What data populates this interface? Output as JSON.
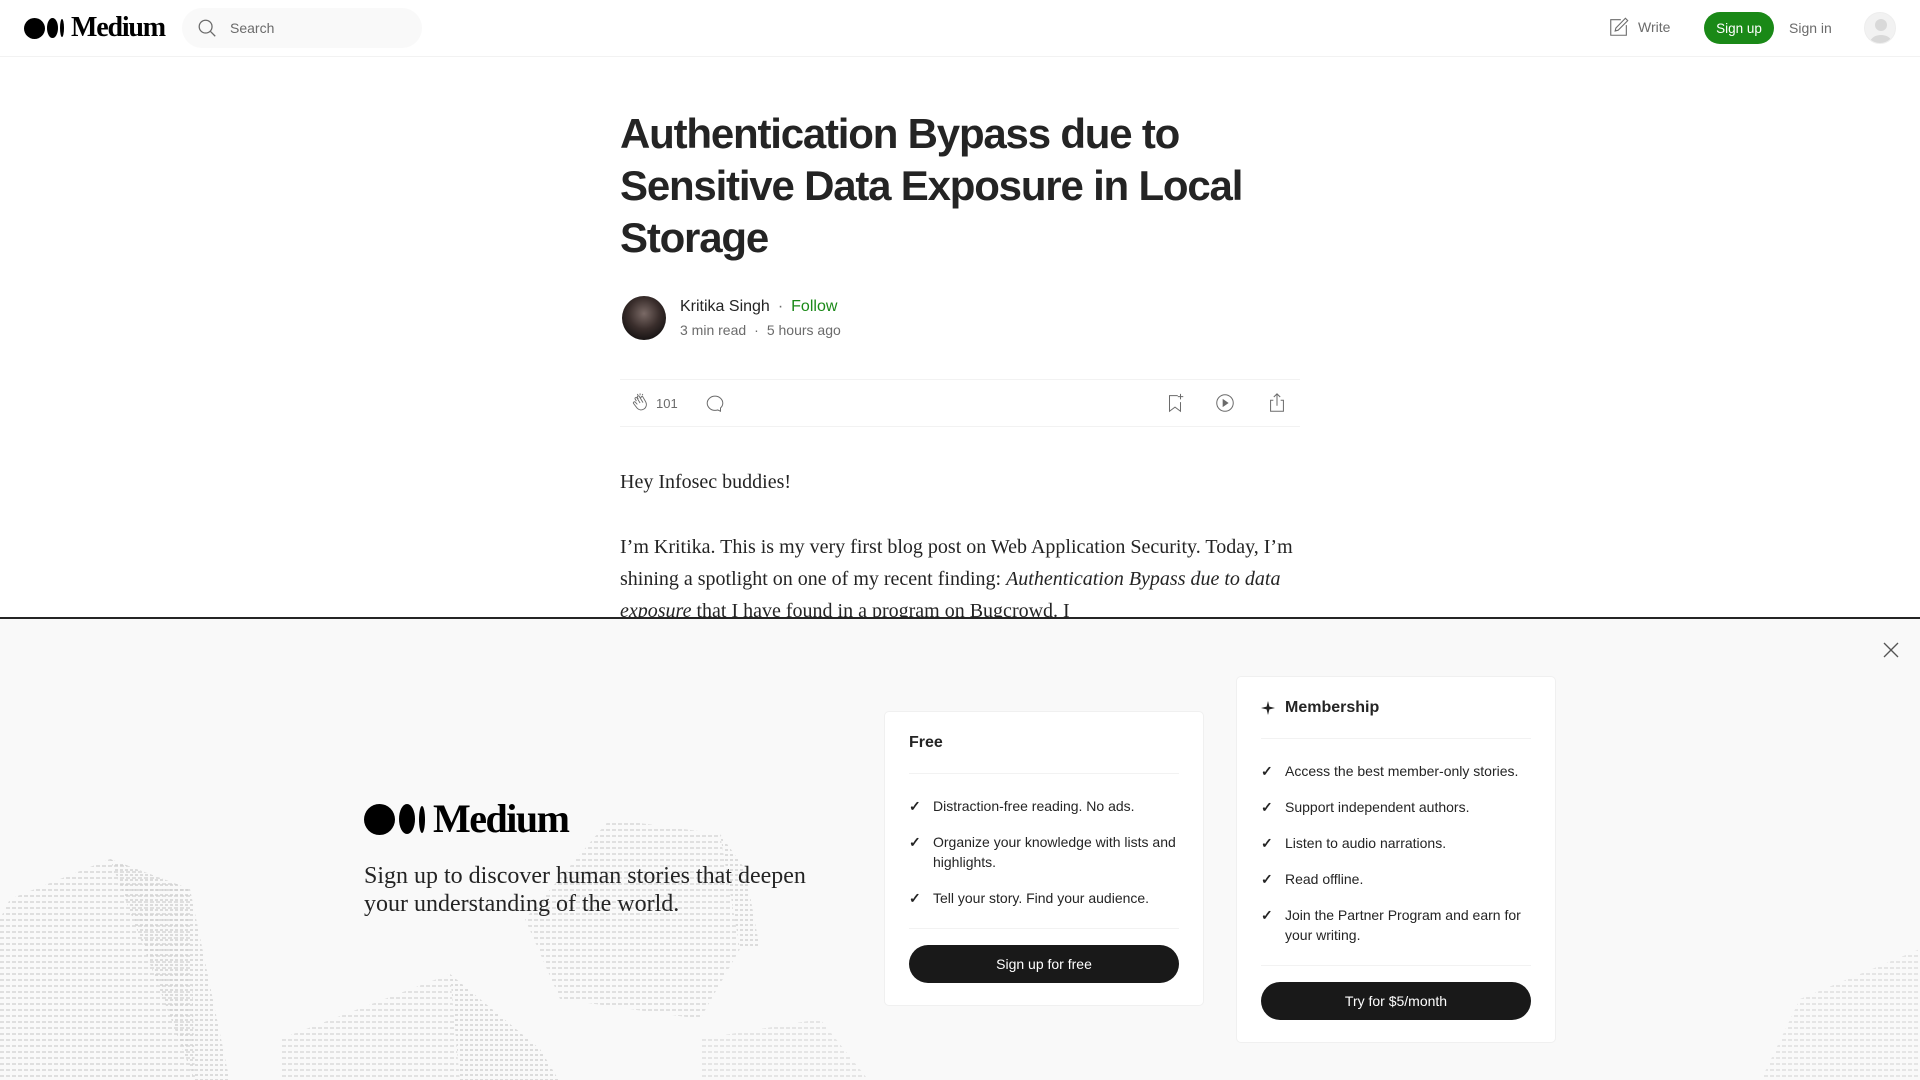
{
  "header": {
    "logo_text": "Medium",
    "search_placeholder": "Search",
    "write_label": "Write",
    "signup_label": "Sign up",
    "signin_label": "Sign in"
  },
  "article": {
    "title": "Authentication Bypass due to Sensitive Data Exposure in Local Storage",
    "author": "Kritika Singh",
    "follow_label": "Follow",
    "read_time": "3 min read",
    "published": "5 hours ago",
    "separator": "·",
    "clap_count": "101",
    "paragraphs": {
      "p1": "Hey Infosec buddies!",
      "p2_start": "I’m Kritika. This is my very first blog post on Web Application Security. Today, I’m shining a spotlight on one of my recent finding: ",
      "p2_em": "Authentication Bypass due to data exposure",
      "p2_end": " that I have found in a program on Bugcrowd. I"
    }
  },
  "overlay": {
    "logo_text": "Medium",
    "tagline": "Sign up to discover human stories that deepen your understanding of the world.",
    "free_card": {
      "title": "Free",
      "features": [
        "Distraction-free reading. No ads.",
        "Organize your knowledge with lists and highlights.",
        "Tell your story. Find your audience."
      ],
      "button_label": "Sign up for free"
    },
    "member_card": {
      "title": "Membership",
      "features": [
        "Access the best member-only stories.",
        "Support independent authors.",
        "Listen to audio narrations.",
        "Read offline.",
        "Join the Partner Program and earn for your writing."
      ],
      "button_label": "Try for $5/month"
    },
    "check_glyph": "✓"
  },
  "colors": {
    "brand_green": "#1a8917",
    "text_primary": "#242424",
    "text_secondary": "#6b6b6b",
    "button_dark": "#191919",
    "overlay_bg": "#f9f9f9"
  }
}
